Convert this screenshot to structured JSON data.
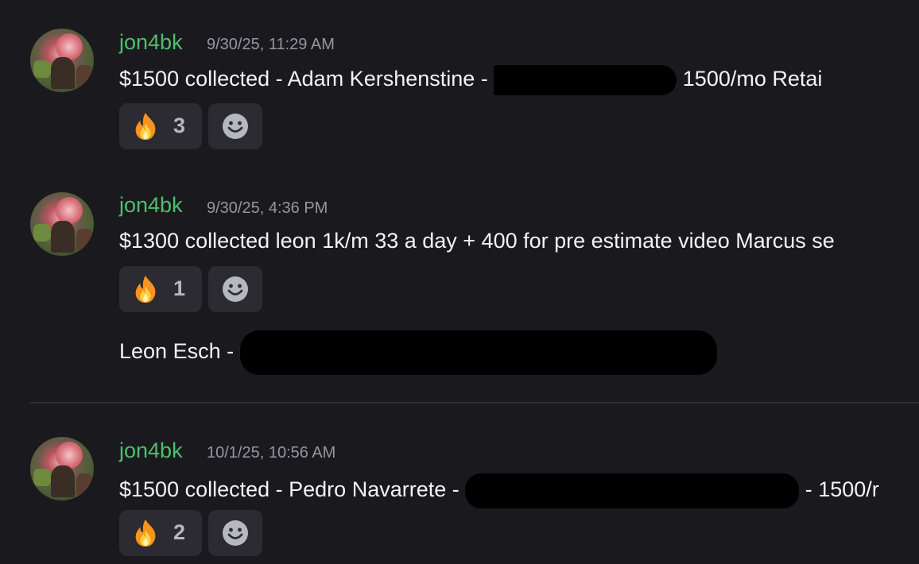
{
  "messages": [
    {
      "username": "jon4bk",
      "timestamp": "9/30/25, 11:29 AM",
      "text_before": "$1500 collected - Adam Kershenstine - ",
      "text_after": " 1500/mo Retai",
      "reaction": {
        "emoji": "fire-emoji",
        "count": "3"
      }
    },
    {
      "username": "jon4bk",
      "timestamp": "9/30/25, 4:36 PM",
      "text": "$1300 collected leon 1k/m 33 a day + 400 for pre estimate video Marcus se",
      "reaction": {
        "emoji": "fire-emoji",
        "count": "1"
      },
      "followup_before": "Leon Esch - "
    },
    {
      "username": "jon4bk",
      "timestamp": "10/1/25, 10:56 AM",
      "text_before": "$1500 collected - Pedro Navarrete - ",
      "text_after": " - 1500/r",
      "reaction": {
        "emoji": "fire-emoji",
        "count": "2"
      }
    }
  ],
  "colors": {
    "background": "#1a1a1e",
    "username": "#4fbe6e",
    "timestamp": "#94979e",
    "text": "#f2f3f5",
    "reaction_bg": "#2b2b31"
  }
}
